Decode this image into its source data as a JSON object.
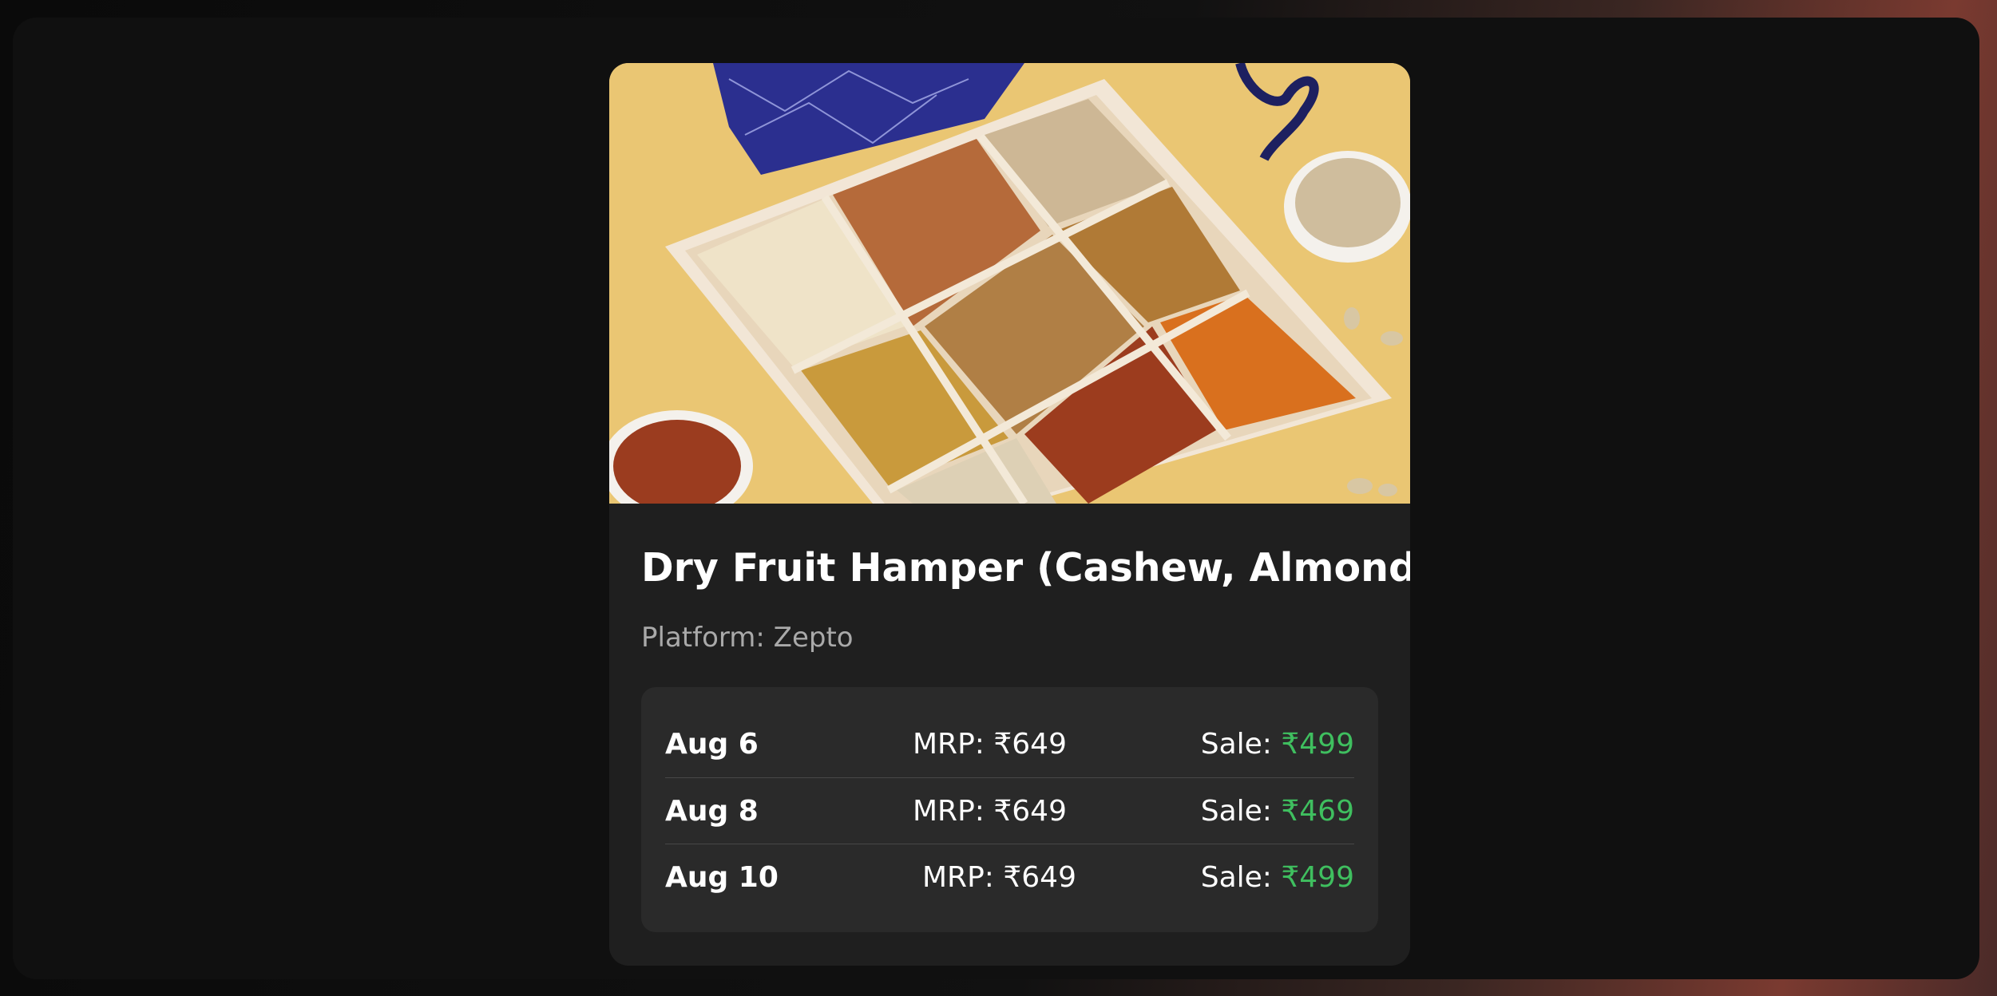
{
  "product": {
    "title": "Dry Fruit Hamper (Cashew, Almonds)",
    "platform_label": "Platform:",
    "platform": "Zepto",
    "image_icon": "dry-fruit-hamper-photo"
  },
  "price_history": {
    "mrp_label": "MRP:",
    "sale_label": "Sale:",
    "rows": [
      {
        "date": "Aug 6",
        "mrp": "₹649",
        "sale": "₹499"
      },
      {
        "date": "Aug 8",
        "mrp": "₹649",
        "sale": "₹469"
      },
      {
        "date": "Aug 10",
        "mrp": "₹649",
        "sale": "₹499"
      }
    ]
  },
  "colors": {
    "background": "#101010",
    "card": "#1f1f1f",
    "panel": "#2a2a2a",
    "sale_price": "#3fbf5f",
    "muted_text": "#a9a9a9"
  }
}
